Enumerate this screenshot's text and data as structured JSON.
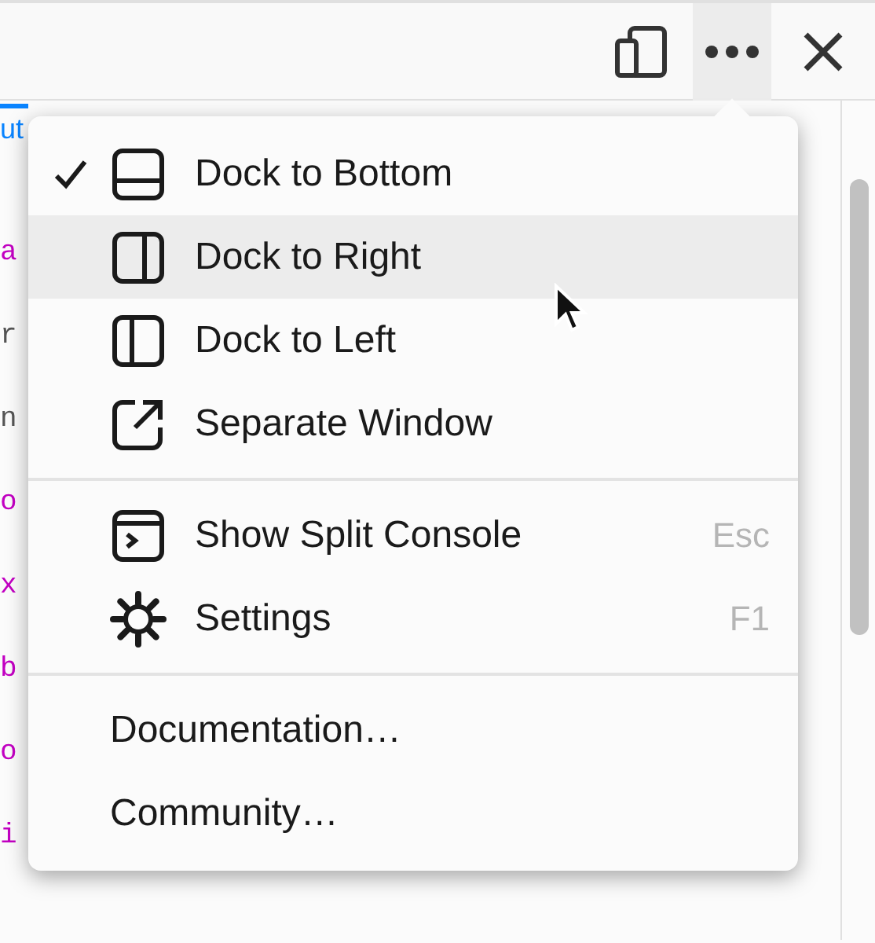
{
  "tab_bar": {
    "tabs": [
      {
        "label": "ut",
        "selected": true
      }
    ]
  },
  "panel_fragments": [
    {
      "text": "a",
      "kind": "tag"
    },
    {
      "text": "r",
      "kind": "plain"
    },
    {
      "text": "n",
      "kind": "plain"
    },
    {
      "text": "o",
      "kind": "tag"
    },
    {
      "text": "x",
      "kind": "tag"
    },
    {
      "text": "b",
      "kind": "tag"
    },
    {
      "text": "o",
      "kind": "tag"
    },
    {
      "text": "i",
      "kind": "tag"
    }
  ],
  "menu": {
    "sections": [
      {
        "items": [
          {
            "label": "Dock to Bottom",
            "kind": "dock-bottom",
            "checked": true,
            "hovered": false
          },
          {
            "label": "Dock to Right",
            "kind": "dock-right",
            "checked": false,
            "hovered": true
          },
          {
            "label": "Dock to Left",
            "kind": "dock-left",
            "checked": false,
            "hovered": false
          },
          {
            "label": "Separate Window",
            "kind": "window",
            "checked": false,
            "hovered": false
          }
        ]
      },
      {
        "items": [
          {
            "label": "Show Split Console",
            "kind": "console",
            "shortcut": "Esc",
            "checked": false,
            "hovered": false
          },
          {
            "label": "Settings",
            "kind": "settings",
            "shortcut": "F1",
            "checked": false,
            "hovered": false
          }
        ]
      },
      {
        "items": [
          {
            "label": "Documentation…",
            "kind": "plain",
            "checked": false,
            "hovered": false
          },
          {
            "label": "Community…",
            "kind": "plain",
            "checked": false,
            "hovered": false
          }
        ]
      }
    ]
  }
}
